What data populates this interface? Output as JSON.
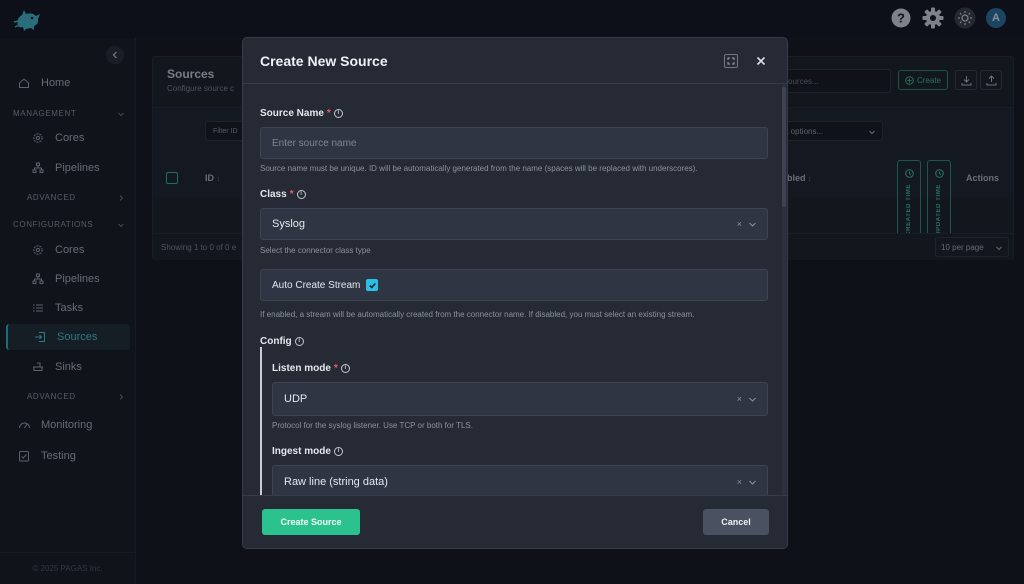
{
  "topbar": {
    "avatar_initial": "A",
    "icons": [
      "help-icon",
      "gear-icon",
      "sun-icon"
    ]
  },
  "sidebar": {
    "home": "Home",
    "management_group": "MANAGEMENT",
    "management_items": [
      "Cores",
      "Pipelines"
    ],
    "management_advanced": "ADVANCED",
    "configurations_group": "CONFIGURATIONS",
    "configuration_items": [
      "Cores",
      "Pipelines",
      "Tasks",
      "Sources",
      "Sinks"
    ],
    "active_item": "Sources",
    "configurations_advanced": "ADVANCED",
    "monitoring": "Monitoring",
    "testing": "Testing",
    "footer": "© 2025 PAGAS Inc."
  },
  "background_page": {
    "title": "Sources",
    "subtitle": "Configure source c",
    "search_placeholder": "ources...",
    "create_label": "Create",
    "filter_placeholder": "Filter ID",
    "select_placeholder": "lect options...",
    "columns": {
      "id": "ID",
      "enabled": "abled",
      "created": "CREATED TIME",
      "updated": "UPDATED TIME",
      "actions": "Actions"
    },
    "showing": "Showing 1 to 0 of 0 e",
    "per_page": "10 per page"
  },
  "modal": {
    "title": "Create New Source",
    "source_name": {
      "label": "Source Name",
      "required": "*",
      "placeholder": "Enter source name",
      "help": "Source name must be unique. ID will be automatically generated from the name (spaces will be replaced with underscores)."
    },
    "class": {
      "label": "Class",
      "required": "*",
      "value": "Syslog",
      "help": "Select the connector class type"
    },
    "auto_create": {
      "label": "Auto Create Stream",
      "checked": true,
      "help": "If enabled, a stream will be automatically created from the connector name. If disabled, you must select an existing stream."
    },
    "config_label": "Config",
    "listen_mode": {
      "label": "Listen mode",
      "required": "*",
      "value": "UDP",
      "help": "Protocol for the syslog listener. Use TCP or both for TLS."
    },
    "ingest_mode": {
      "label": "Ingest mode",
      "value": "Raw line (string data)"
    },
    "create_button": "Create Source",
    "cancel_button": "Cancel"
  }
}
